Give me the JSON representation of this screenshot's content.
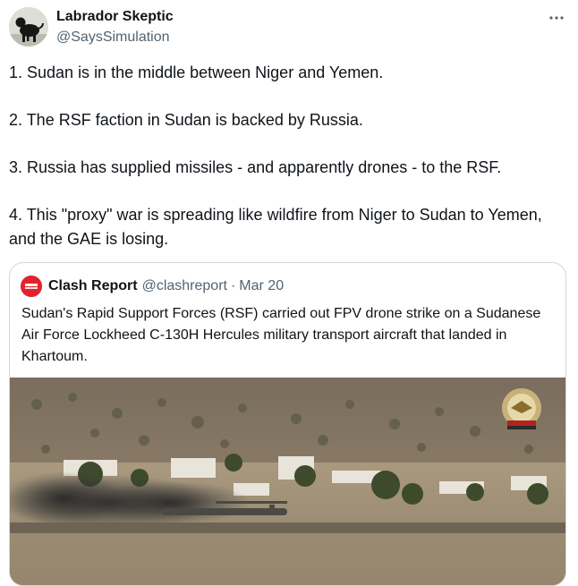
{
  "author": {
    "name": "Labrador Skeptic",
    "handle": "@SaysSimulation"
  },
  "tweet": {
    "paragraphs": [
      "1. Sudan is in the middle between Niger and Yemen.",
      "2. The RSF faction in Sudan is backed by Russia.",
      "3. Russia has supplied missiles - and apparently drones - to the RSF.",
      "4. This \"proxy\" war is spreading like wildfire from Niger to Sudan to Yemen, and the GAE is losing."
    ]
  },
  "quote": {
    "name": "Clash Report",
    "handle": "@clashreport",
    "separator": "·",
    "date": "Mar 20",
    "text": "Sudan's Rapid Support Forces (RSF) carried out  FPV drone strike on a Sudanese Air Force Lockheed C-130H Hercules military transport aircraft that landed in Khartoum.",
    "logo_icon": "clash-report-logo",
    "media_icon": "video-thumbnail"
  },
  "icons": {
    "more": "more-horizontal-icon"
  },
  "colors": {
    "text_primary": "#0f1419",
    "text_secondary": "#536471",
    "border": "#cfd9de",
    "logo_red": "#e0232e"
  }
}
